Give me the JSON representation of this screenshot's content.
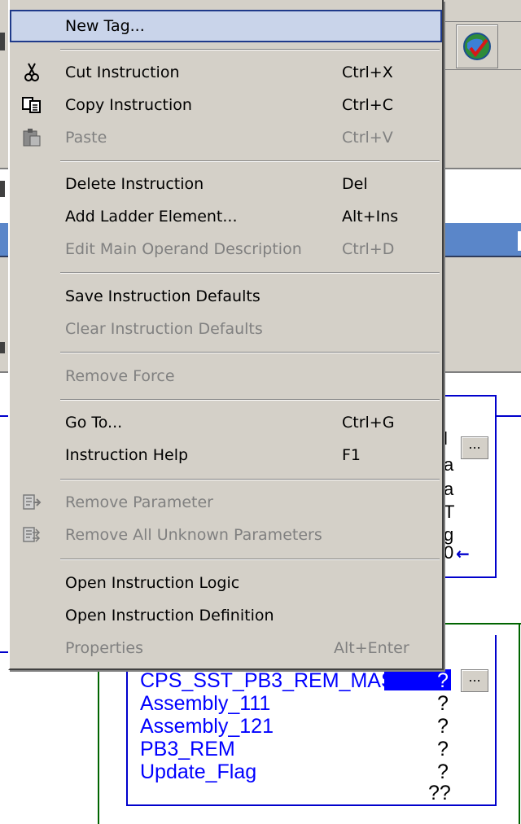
{
  "context_menu": {
    "items": [
      {
        "label": "New Tag...",
        "shortcut": "",
        "enabled": true,
        "highlighted": true
      },
      {
        "label": "Cut Instruction",
        "shortcut": "Ctrl+X",
        "enabled": true,
        "icon": "cut-icon"
      },
      {
        "label": "Copy Instruction",
        "shortcut": "Ctrl+C",
        "enabled": true,
        "icon": "copy-icon"
      },
      {
        "label": "Paste",
        "shortcut": "Ctrl+V",
        "enabled": false,
        "icon": "paste-icon"
      },
      {
        "label": "Delete Instruction",
        "shortcut": "Del",
        "enabled": true
      },
      {
        "label": "Add Ladder Element...",
        "shortcut": "Alt+Ins",
        "enabled": true
      },
      {
        "label": "Edit Main Operand Description",
        "shortcut": "Ctrl+D",
        "enabled": false
      },
      {
        "label": "Save Instruction Defaults",
        "shortcut": "",
        "enabled": true
      },
      {
        "label": "Clear Instruction Defaults",
        "shortcut": "",
        "enabled": false
      },
      {
        "label": "Remove Force",
        "shortcut": "",
        "enabled": false
      },
      {
        "label": "Go To...",
        "shortcut": "Ctrl+G",
        "enabled": true
      },
      {
        "label": "Instruction Help",
        "shortcut": "F1",
        "enabled": true
      },
      {
        "label": "Remove Parameter",
        "shortcut": "",
        "enabled": false,
        "icon": "remove-parameter-icon"
      },
      {
        "label": "Remove All Unknown Parameters",
        "shortcut": "",
        "enabled": false,
        "icon": "remove-all-parameters-icon"
      },
      {
        "label": "Open Instruction Logic",
        "shortcut": "",
        "enabled": true
      },
      {
        "label": "Open Instruction Definition",
        "shortcut": "",
        "enabled": true
      },
      {
        "label": "Properties",
        "shortcut": "Alt+Enter",
        "enabled": false
      }
    ]
  },
  "ladder": {
    "upper_box_fragments": [
      "l",
      "a",
      "a",
      "T",
      "g",
      "0"
    ],
    "browse_button_label": "...",
    "lower_box": {
      "rows": [
        {
          "tag": "CPS_SST_PB3_REM_MAST...",
          "value": "?"
        },
        {
          "tag": "Assembly_111",
          "value": "?"
        },
        {
          "tag": "Assembly_121",
          "value": "?"
        },
        {
          "tag": "PB3_REM",
          "value": "?"
        },
        {
          "tag": "Update_Flag",
          "value": "?"
        },
        {
          "tag": "",
          "value": "??"
        }
      ]
    }
  },
  "colors": {
    "menu_bg": "#d4d0c8",
    "highlight": "#c9d4ea",
    "ladder_blue": "#0000cc",
    "rail_green": "#006400",
    "selection_blue": "#0000ff"
  }
}
